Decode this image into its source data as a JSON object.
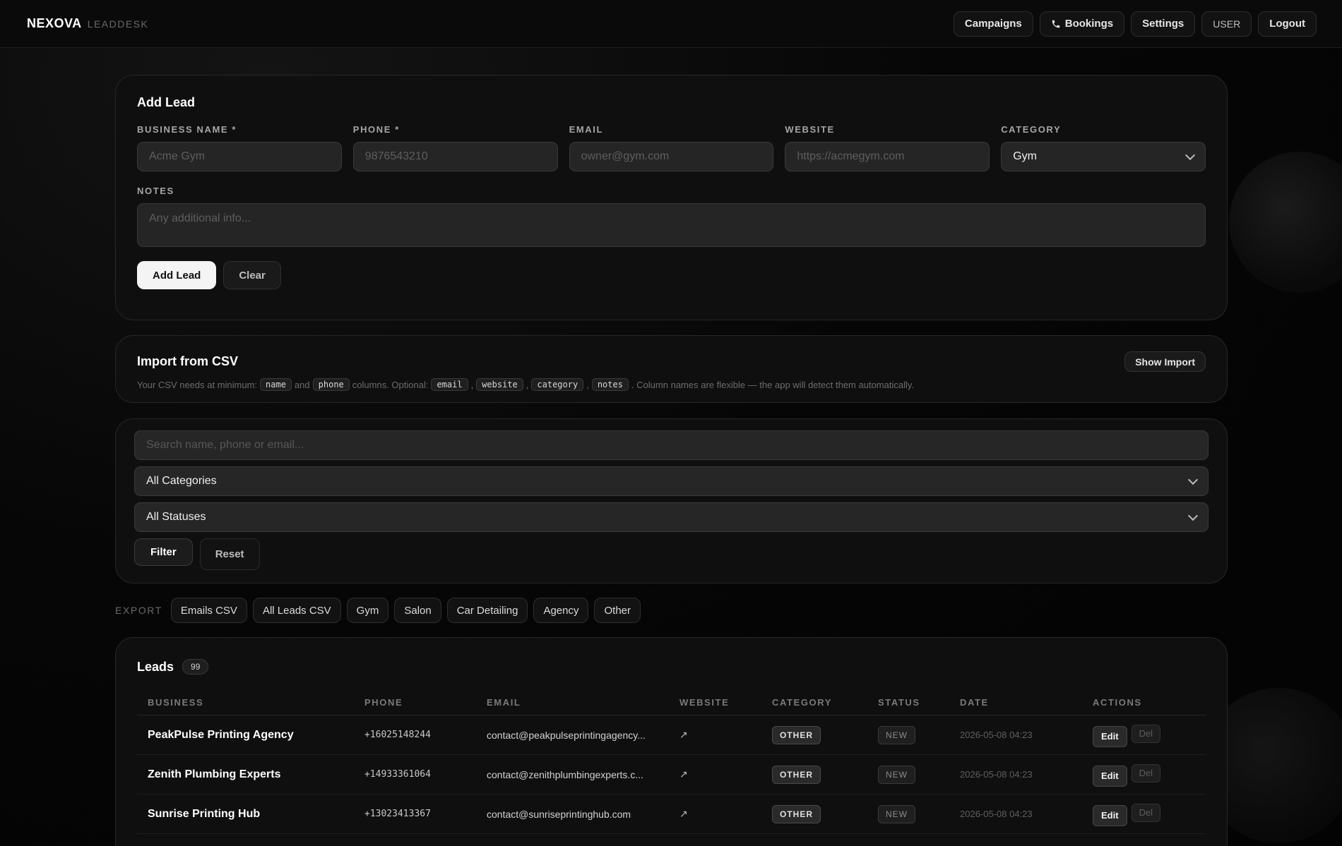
{
  "brand": {
    "name": "NEXOVA",
    "sub": "LEADDESK"
  },
  "nav": {
    "campaigns": "Campaigns",
    "bookings": "Bookings",
    "settings": "Settings",
    "user": "USER",
    "logout": "Logout"
  },
  "add_lead": {
    "title": "Add Lead",
    "fields": {
      "business_name": {
        "label": "BUSINESS NAME *",
        "placeholder": "Acme Gym"
      },
      "phone": {
        "label": "PHONE *",
        "placeholder": "9876543210"
      },
      "email": {
        "label": "EMAIL",
        "placeholder": "owner@gym.com"
      },
      "website": {
        "label": "WEBSITE",
        "placeholder": "https://acmegym.com"
      },
      "category": {
        "label": "CATEGORY",
        "value": "Gym"
      },
      "notes": {
        "label": "NOTES",
        "placeholder": "Any additional info..."
      }
    },
    "submit_label": "Add Lead",
    "clear_label": "Clear"
  },
  "import_csv": {
    "title": "Import from CSV",
    "show_label": "Show Import",
    "desc_1": "Your CSV needs at minimum:",
    "code_name": "name",
    "desc_and": "and",
    "code_phone": "phone",
    "desc_2": "columns. Optional:",
    "code_email": "email",
    "code_website": "website",
    "code_category": "category",
    "code_notes": "notes",
    "comma": ",",
    "desc_3": ". Column names are flexible — the app will detect them automatically."
  },
  "filters": {
    "search_placeholder": "Search name, phone or email...",
    "category_value": "All Categories",
    "status_value": "All Statuses",
    "filter_label": "Filter",
    "reset_label": "Reset"
  },
  "export": {
    "label": "EXPORT",
    "buttons": [
      "Emails CSV",
      "All Leads CSV",
      "Gym",
      "Salon",
      "Car Detailing",
      "Agency",
      "Other"
    ]
  },
  "leads": {
    "title": "Leads",
    "count": "99",
    "columns": [
      "BUSINESS",
      "PHONE",
      "EMAIL",
      "WEBSITE",
      "CATEGORY",
      "STATUS",
      "DATE",
      "ACTIONS"
    ],
    "rows": [
      {
        "business": "PeakPulse Printing Agency",
        "phone": "+16025148244",
        "email": "contact@peakpulseprintingagency...",
        "website": "↗",
        "category": "OTHER",
        "status": "NEW",
        "date": "2026-05-08 04:23",
        "edit": "Edit",
        "del": "Del"
      },
      {
        "business": "Zenith Plumbing Experts",
        "phone": "+14933361064",
        "email": "contact@zenithplumbingexperts.c...",
        "website": "↗",
        "category": "OTHER",
        "status": "NEW",
        "date": "2026-05-08 04:23",
        "edit": "Edit",
        "del": "Del"
      },
      {
        "business": "Sunrise Printing Hub",
        "phone": "+13023413367",
        "email": "contact@sunriseprintinghub.com",
        "website": "↗",
        "category": "OTHER",
        "status": "NEW",
        "date": "2026-05-08 04:23",
        "edit": "Edit",
        "del": "Del"
      }
    ]
  }
}
